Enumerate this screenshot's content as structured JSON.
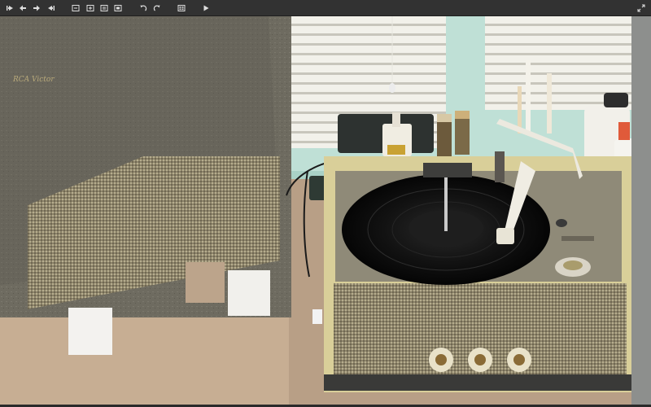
{
  "toolbar": {
    "buttons": [
      {
        "name": "first-image-button",
        "icon": "skip-first-icon"
      },
      {
        "name": "previous-image-button",
        "icon": "arrow-left-icon"
      },
      {
        "name": "next-image-button",
        "icon": "arrow-right-icon"
      },
      {
        "name": "last-image-button",
        "icon": "skip-last-icon"
      },
      {
        "name": "zoom-fit-button",
        "icon": "fit-window-icon"
      },
      {
        "name": "zoom-in-button",
        "icon": "zoom-grid-icon"
      },
      {
        "name": "actual-size-button",
        "icon": "actual-size-icon"
      },
      {
        "name": "fit-width-button",
        "icon": "fit-width-icon"
      },
      {
        "name": "rotate-left-button",
        "icon": "rotate-left-icon"
      },
      {
        "name": "rotate-right-button",
        "icon": "rotate-right-icon"
      },
      {
        "name": "gallery-button",
        "icon": "gallery-grid-icon"
      },
      {
        "name": "slideshow-button",
        "icon": "play-icon"
      },
      {
        "name": "fullscreen-button",
        "icon": "fullscreen-toggle-icon"
      }
    ]
  },
  "photo": {
    "brand_label": "RCA Victor",
    "colors": {
      "amp_body": "#6e6b60",
      "grille": "#9b9276",
      "record": "#141414",
      "platter_deck": "#8e8a78",
      "case_trim": "#d8cf98",
      "wall": "#bfe0d6",
      "paper": "#cdb8a0"
    }
  }
}
